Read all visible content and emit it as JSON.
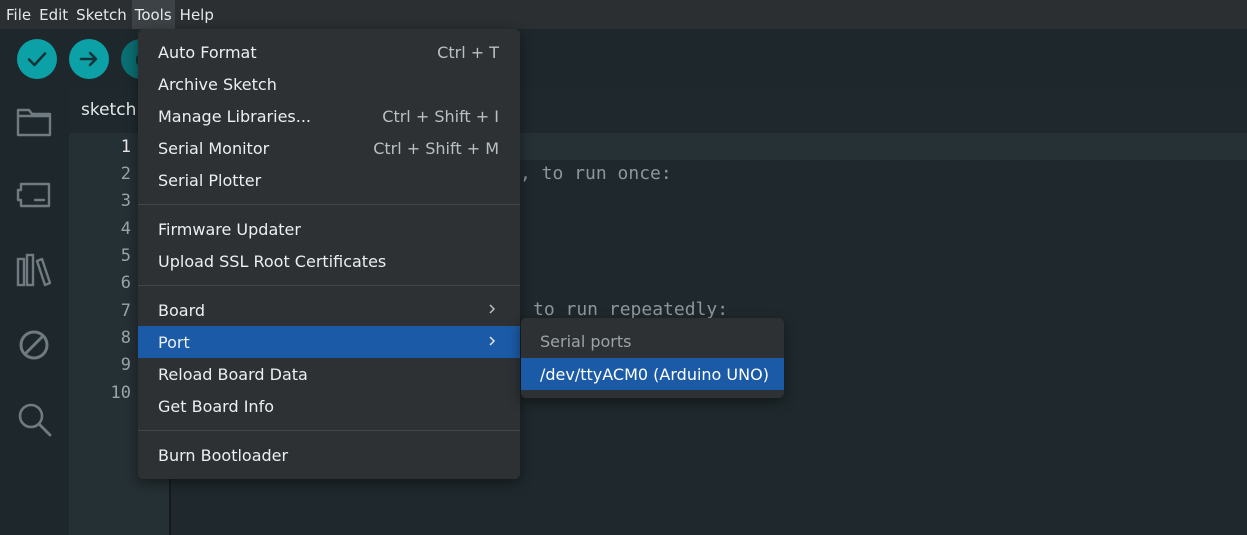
{
  "menubar": {
    "items": [
      "File",
      "Edit",
      "Sketch",
      "Tools",
      "Help"
    ],
    "active": "Tools"
  },
  "toolbar": {
    "verify_icon": "check-icon",
    "upload_icon": "arrow-right-icon",
    "debugger_icon": "debug-icon"
  },
  "sidebar": {
    "icons": [
      "folder-icon",
      "board-icon",
      "library-icon",
      "block-icon",
      "search-icon"
    ]
  },
  "editor": {
    "tab_label": "sketch",
    "line_numbers": [
      "1",
      "2",
      "3",
      "4",
      "5",
      "6",
      "7",
      "8",
      "9",
      "10"
    ],
    "current_line": "1",
    "code_fragments": {
      "line2": ", to run once:",
      "line7": "to run repeatedly:"
    }
  },
  "tools_menu": {
    "auto_format": {
      "label": "Auto Format",
      "shortcut": "Ctrl + T"
    },
    "archive_sketch": {
      "label": "Archive Sketch"
    },
    "manage_libraries": {
      "label": "Manage Libraries...",
      "shortcut": "Ctrl + Shift + I"
    },
    "serial_monitor": {
      "label": "Serial Monitor",
      "shortcut": "Ctrl + Shift + M"
    },
    "serial_plotter": {
      "label": "Serial Plotter"
    },
    "firmware_updater": {
      "label": "Firmware Updater"
    },
    "upload_ssl": {
      "label": "Upload SSL Root Certificates"
    },
    "board": {
      "label": "Board"
    },
    "port": {
      "label": "Port"
    },
    "reload_board_data": {
      "label": "Reload Board Data"
    },
    "get_board_info": {
      "label": "Get Board Info"
    },
    "burn_bootloader": {
      "label": "Burn Bootloader"
    }
  },
  "port_submenu": {
    "header": "Serial ports",
    "items": [
      "/dev/ttyACM0 (Arduino UNO)"
    ]
  },
  "colors": {
    "accent": "#0ca1a6",
    "highlight": "#1b5aa6",
    "menu_bg": "#2d3133"
  }
}
